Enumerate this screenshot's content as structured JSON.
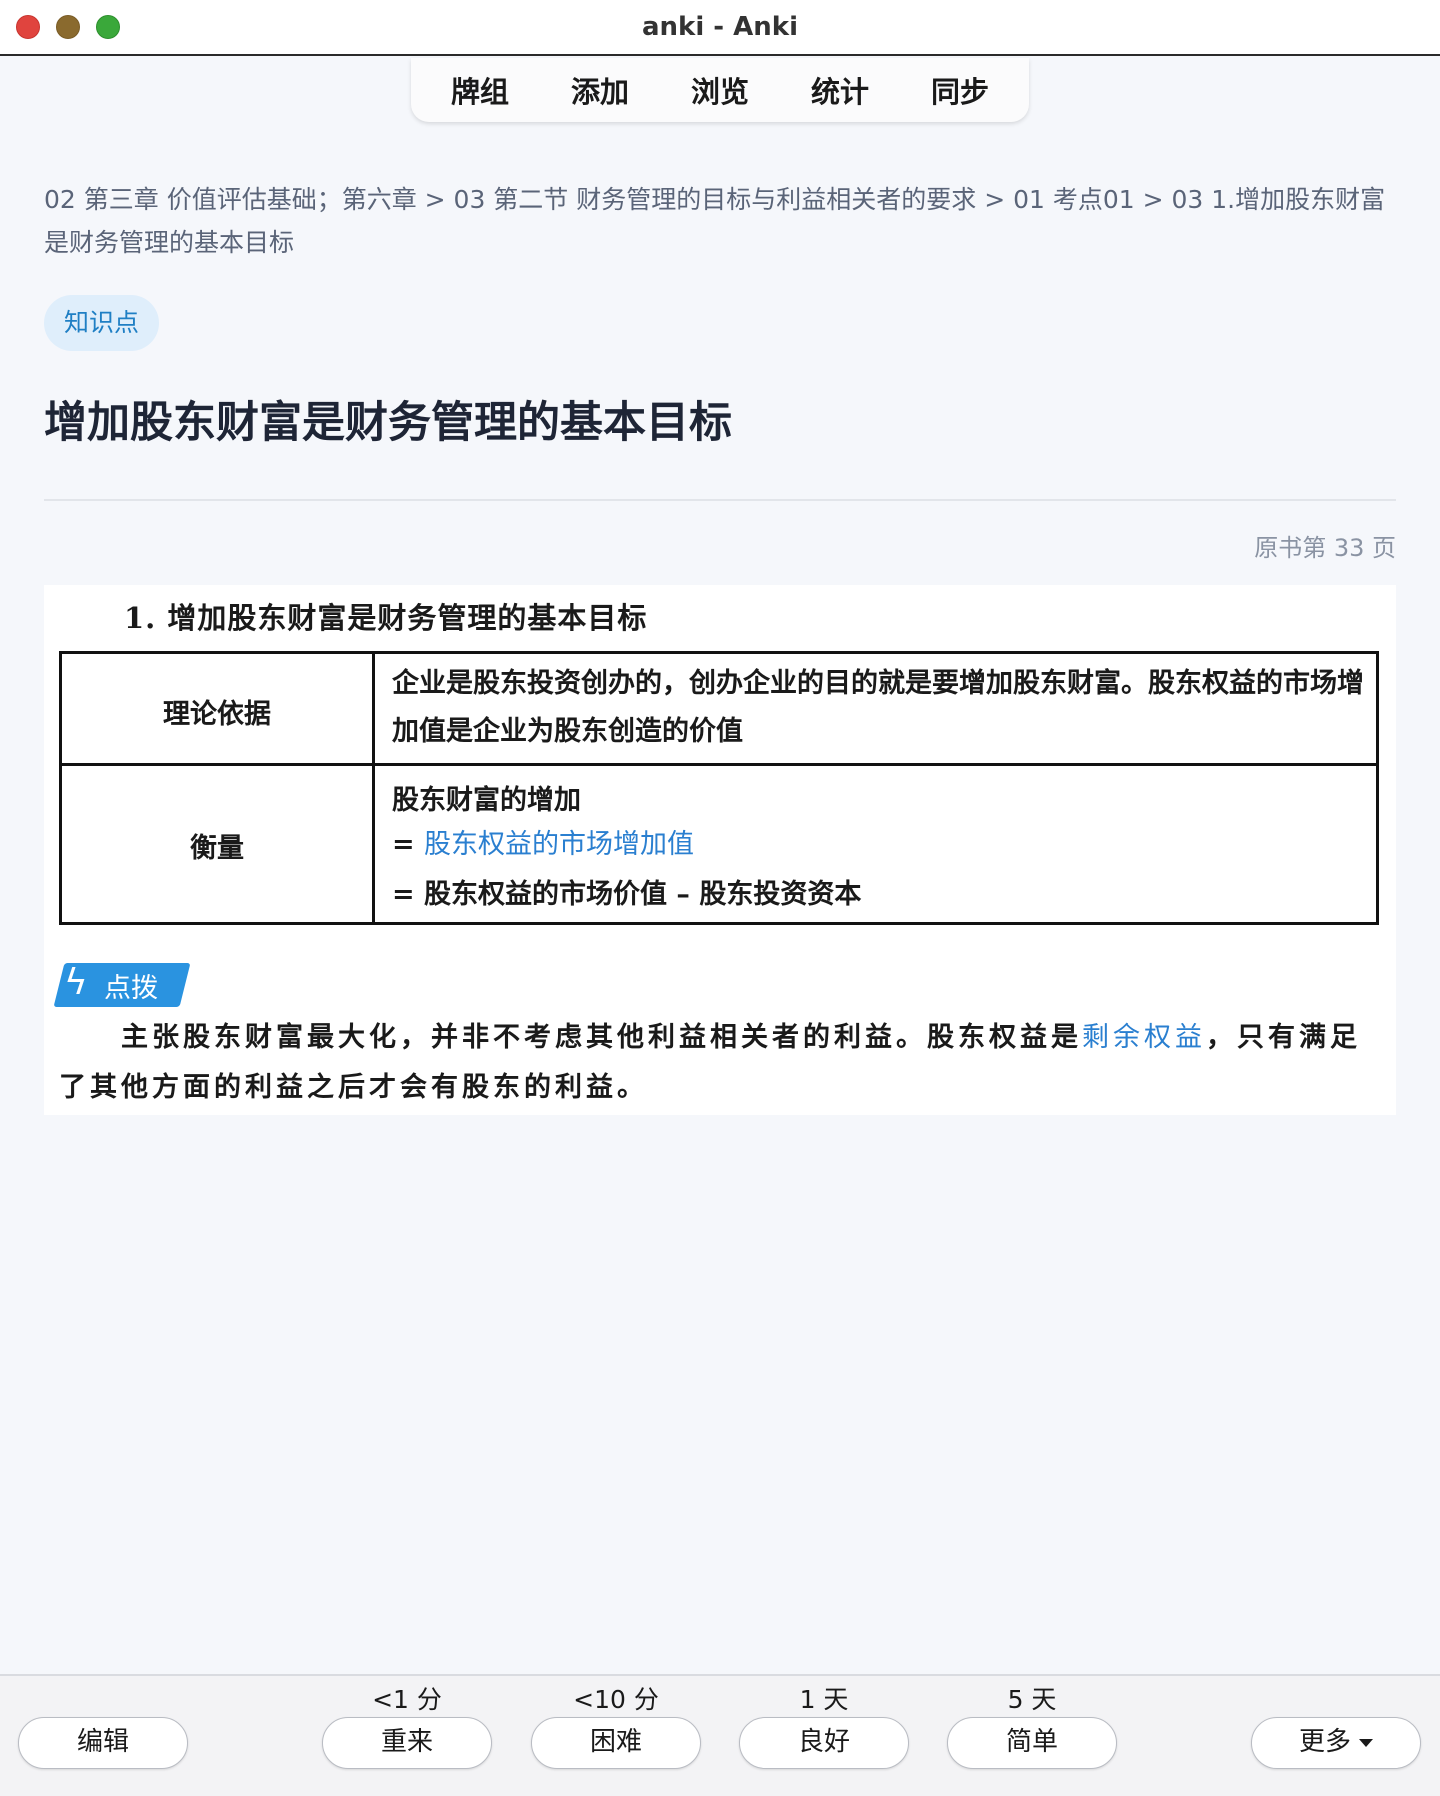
{
  "window": {
    "title": "anki - Anki"
  },
  "nav": {
    "items": [
      "牌组",
      "添加",
      "浏览",
      "统计",
      "同步"
    ]
  },
  "card": {
    "breadcrumb": "02 第三章 价值评估基础；第六章 > 03 第二节 财务管理的目标与利益相关者的要求 > 01 考点01 > 03 1.增加股东财富是财务管理的基本目标",
    "tag": "知识点",
    "title": "增加股东财富是财务管理的基本目标",
    "page_ref": "原书第 33 页"
  },
  "scan": {
    "heading": "1. 增加股东财富是财务管理的基本目标",
    "row1_label": "理论依据",
    "row1_text": "企业是股东投资创办的，创办企业的目的就是要增加股东财富。股东权益的市场增加值是企业为股东创造的价值",
    "row2_label": "衡量",
    "row2_line1": "股东财富的增加",
    "row2_line2_prefix": "= ",
    "row2_line2_blue": "股东权益的市场增加值",
    "row2_line3": "= 股东权益的市场价值 – 股东投资资本",
    "tip_label": "点拨",
    "tip_text_1": "主张股东财富最大化，并非不考虑其他利益相关者的利益。股东权益是",
    "tip_text_blue": "剩余权益",
    "tip_text_2": "，只有满足了其他方面的利益之后才会有股东的利益。"
  },
  "answer_bar": {
    "intervals": [
      "<1 分",
      "<10 分",
      "1 天",
      "5 天"
    ],
    "edit_label": "编辑",
    "again_label": "重来",
    "hard_label": "困难",
    "good_label": "良好",
    "easy_label": "简单",
    "more_label": "更多"
  },
  "colors": {
    "accent": "#1f7fc4",
    "highlight_blue": "#2a7fd0",
    "tag_bg": "#dfeefb"
  }
}
